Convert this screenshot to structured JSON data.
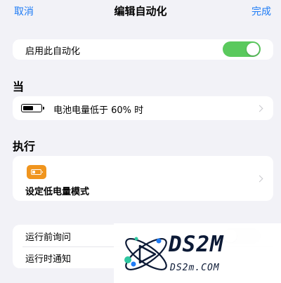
{
  "nav": {
    "cancel": "取消",
    "title": "编辑自动化",
    "done": "完成"
  },
  "enable_row": {
    "label": "启用此自动化",
    "toggle_on": true,
    "toggle_on_color": "#5ac95d"
  },
  "when_section": {
    "title": "当",
    "trigger_label": "电池电量低于 60% 时",
    "battery_level_percent": 60
  },
  "do_section": {
    "title": "执行",
    "action_label": "设定低电量模式",
    "action_icon_color": "#f0951e"
  },
  "options": {
    "ask_before_running": {
      "label": "运行前询问",
      "toggle_on": false
    },
    "notify_when_run": {
      "label": "运行时通知"
    }
  },
  "watermark": {
    "brand": "DS2M",
    "domain": "DS2m.COM"
  },
  "colors": {
    "accent": "#1f7cf5",
    "background": "#f2f2f7",
    "toggle_off": "#e9e9eb"
  }
}
